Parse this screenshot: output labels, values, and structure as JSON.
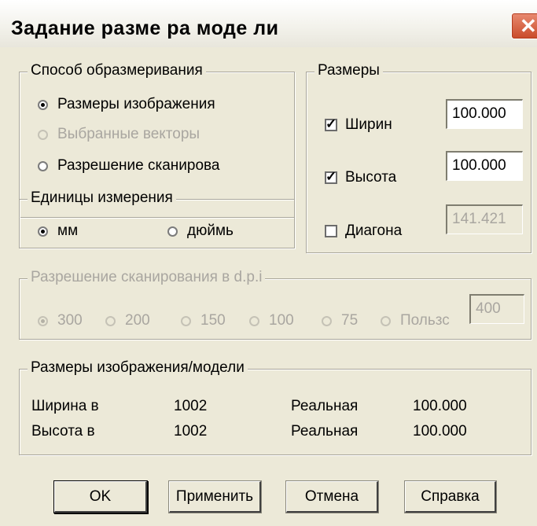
{
  "dialog": {
    "title": "Задание разме ра моде ли"
  },
  "sizing_method": {
    "legend": "Способ образмеривания",
    "options": [
      {
        "label": "Размеры изображения",
        "selected": true,
        "enabled": true
      },
      {
        "label": "Выбранные векторы",
        "selected": false,
        "enabled": false
      },
      {
        "label": "Разрешение сканирова",
        "selected": false,
        "enabled": true
      }
    ]
  },
  "units": {
    "legend": "Единицы измерения",
    "options": [
      {
        "label": "мм",
        "selected": true
      },
      {
        "label": "дюймь",
        "selected": false
      }
    ]
  },
  "dimensions": {
    "legend": "Размеры",
    "width": {
      "label": "Ширин",
      "checked": true,
      "value": "100.000"
    },
    "height": {
      "label": "Высота",
      "checked": true,
      "value": "100.000"
    },
    "diagonal": {
      "label": "Диагона",
      "checked": false,
      "value": "141.421"
    }
  },
  "resolution": {
    "legend": "Разрешение сканирования в d.p.i",
    "options": [
      {
        "label": "300",
        "selected": true
      },
      {
        "label": "200",
        "selected": false
      },
      {
        "label": "150",
        "selected": false
      },
      {
        "label": "100",
        "selected": false
      },
      {
        "label": "75",
        "selected": false
      },
      {
        "label": "Пользс",
        "selected": false
      }
    ],
    "custom_value": "400"
  },
  "image_model": {
    "legend": "Размеры изображения/модели",
    "rows": [
      {
        "label": "Ширина в",
        "value": "1002",
        "real_label": "Реальная",
        "real_value": "100.000"
      },
      {
        "label": "Высота в",
        "value": "1002",
        "real_label": "Реальная",
        "real_value": "100.000"
      }
    ]
  },
  "buttons": {
    "ok": "OK",
    "apply": "Применить",
    "cancel": "Отмена",
    "help": "Справка"
  }
}
